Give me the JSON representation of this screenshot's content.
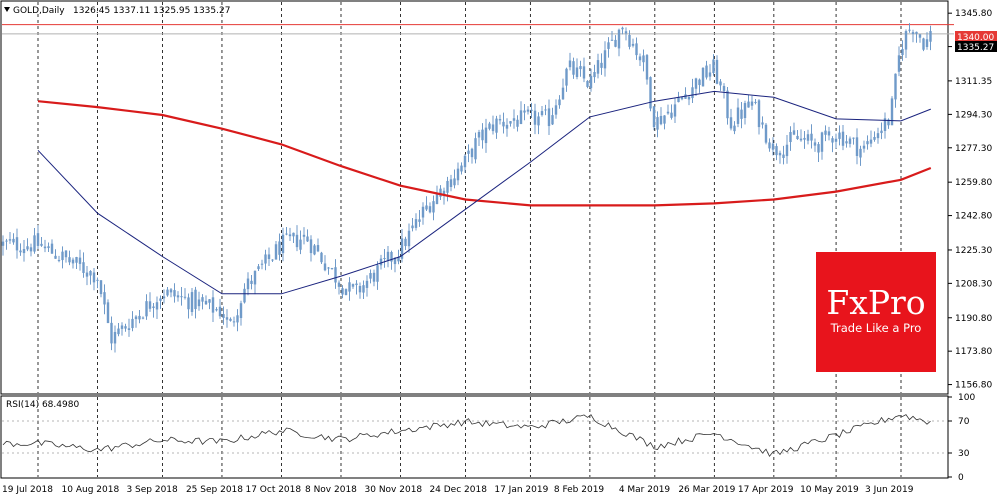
{
  "header": {
    "symbol": "GOLD,Daily",
    "ohlc": "1326.45 1337.11 1325.95 1335.27"
  },
  "price_tags": {
    "level_line": "1340.00",
    "last_price": "1335.27"
  },
  "rsi_header": "RSI(14) 68.4980",
  "logo": {
    "brand": "FxPro",
    "tagline": "Trade Like a Pro",
    "bg_color": "#e8141c"
  },
  "colors": {
    "candle": "#6f9ac9",
    "ma_short": "#1a237e",
    "ma_long": "#d81b1b",
    "hline": "#e53935",
    "rsi": "#333333",
    "grid_v": "#000000"
  },
  "chart_data": [
    {
      "type": "candlestick",
      "title": "GOLD,Daily",
      "date_labels": [
        "19 Jul 2018",
        "10 Aug 2018",
        "3 Sep 2018",
        "25 Sep 2018",
        "17 Oct 2018",
        "8 Nov 2018",
        "30 Nov 2018",
        "24 Dec 2018",
        "17 Jan 2019",
        "8 Feb 2019",
        "4 Mar 2019",
        "26 Mar 2019",
        "17 Apr 2019",
        "10 May 2019",
        "3 Jun 2019"
      ],
      "yticks": [
        "1345.80",
        "1328.80",
        "1311.35",
        "1294.30",
        "1277.30",
        "1259.80",
        "1242.80",
        "1225.30",
        "1208.30",
        "1190.80",
        "1173.80",
        "1156.80"
      ],
      "ylim": [
        1152,
        1352
      ],
      "horizontal_line": 1340.0,
      "last_close": 1335.27,
      "close_path": [
        [
          "19 Jul 2018",
          1228
        ],
        [
          "10 Aug 2018",
          1212
        ],
        [
          "15 Aug 2018",
          1180
        ],
        [
          "3 Sep 2018",
          1204
        ],
        [
          "12 Sep 2018",
          1200
        ],
        [
          "25 Sep 2018",
          1194
        ],
        [
          "28 Sep 2018",
          1186
        ],
        [
          "3 Oct 2018",
          1205
        ],
        [
          "17 Oct 2018",
          1228
        ],
        [
          "26 Oct 2018",
          1232
        ],
        [
          "8 Nov 2018",
          1208
        ],
        [
          "13 Nov 2018",
          1203
        ],
        [
          "30 Nov 2018",
          1226
        ],
        [
          "10 Dec 2018",
          1248
        ],
        [
          "24 Dec 2018",
          1270
        ],
        [
          "28 Dec 2018",
          1280
        ],
        [
          "4 Jan 2019",
          1290
        ],
        [
          "17 Jan 2019",
          1292
        ],
        [
          "24 Jan 2019",
          1292
        ],
        [
          "31 Jan 2019",
          1318
        ],
        [
          "8 Feb 2019",
          1310
        ],
        [
          "20 Feb 2019",
          1340
        ],
        [
          "28 Feb 2019",
          1320
        ],
        [
          "4 Mar 2019",
          1290
        ],
        [
          "11 Mar 2019",
          1298
        ],
        [
          "20 Mar 2019",
          1312
        ],
        [
          "26 Mar 2019",
          1318
        ],
        [
          "1 Apr 2019",
          1290
        ],
        [
          "9 Apr 2019",
          1300
        ],
        [
          "17 Apr 2019",
          1276
        ],
        [
          "25 Apr 2019",
          1282
        ],
        [
          "3 May 2019",
          1279
        ],
        [
          "10 May 2019",
          1285
        ],
        [
          "20 May 2019",
          1276
        ],
        [
          "24 May 2019",
          1284
        ],
        [
          "30 May 2019",
          1292
        ],
        [
          "3 Jun 2019",
          1330
        ],
        [
          "7 Jun 2019",
          1340
        ],
        [
          "12 Jun 2019",
          1330
        ],
        [
          "14 Jun 2019",
          1335.27
        ]
      ],
      "series": [
        {
          "name": "",
          "points": [
            [
              "19 Jul 2018",
              1276
            ],
            [
              "10 Aug 2018",
              1244
            ],
            [
              "3 Sep 2018",
              1222
            ],
            [
              "25 Sep 2018",
              1203
            ],
            [
              "17 Oct 2018",
              1203
            ],
            [
              "8 Nov 2018",
              1212
            ],
            [
              "30 Nov 2018",
              1222
            ],
            [
              "24 Dec 2018",
              1246
            ],
            [
              "17 Jan 2019",
              1270
            ],
            [
              "8 Feb 2019",
              1293
            ],
            [
              "4 Mar 2019",
              1301
            ],
            [
              "26 Mar 2019",
              1306
            ],
            [
              "17 Apr 2019",
              1303
            ],
            [
              "10 May 2019",
              1292
            ],
            [
              "3 Jun 2019",
              1291
            ],
            [
              "14 Jun 2019",
              1297
            ]
          ]
        },
        {
          "name": "",
          "points": [
            [
              "19 Jul 2018",
              1301
            ],
            [
              "10 Aug 2018",
              1298
            ],
            [
              "3 Sep 2018",
              1294
            ],
            [
              "25 Sep 2018",
              1287
            ],
            [
              "17 Oct 2018",
              1279
            ],
            [
              "8 Nov 2018",
              1268
            ],
            [
              "30 Nov 2018",
              1258
            ],
            [
              "24 Dec 2018",
              1251
            ],
            [
              "17 Jan 2019",
              1248
            ],
            [
              "8 Feb 2019",
              1248
            ],
            [
              "4 Mar 2019",
              1248
            ],
            [
              "26 Mar 2019",
              1249
            ],
            [
              "17 Apr 2019",
              1251
            ],
            [
              "10 May 2019",
              1255
            ],
            [
              "3 Jun 2019",
              1261
            ],
            [
              "14 Jun 2019",
              1267
            ]
          ]
        }
      ]
    },
    {
      "type": "line",
      "title": "RSI(14) 68.4980",
      "yticks": [
        "100",
        "70",
        "30",
        "0"
      ],
      "ylim": [
        0,
        100
      ],
      "levels": [
        70,
        30
      ],
      "value_path": [
        [
          "19 Jul 2018",
          42
        ],
        [
          "10 Aug 2018",
          34
        ],
        [
          "3 Sep 2018",
          46
        ],
        [
          "25 Sep 2018",
          44
        ],
        [
          "17 Oct 2018",
          58
        ],
        [
          "8 Nov 2018",
          47
        ],
        [
          "30 Nov 2018",
          58
        ],
        [
          "24 Dec 2018",
          69
        ],
        [
          "17 Jan 2019",
          62
        ],
        [
          "8 Feb 2019",
          76
        ],
        [
          "4 Mar 2019",
          38
        ],
        [
          "26 Mar 2019",
          55
        ],
        [
          "17 Apr 2019",
          28
        ],
        [
          "10 May 2019",
          52
        ],
        [
          "3 Jun 2019",
          78
        ],
        [
          "14 Jun 2019",
          68.498
        ]
      ]
    }
  ]
}
